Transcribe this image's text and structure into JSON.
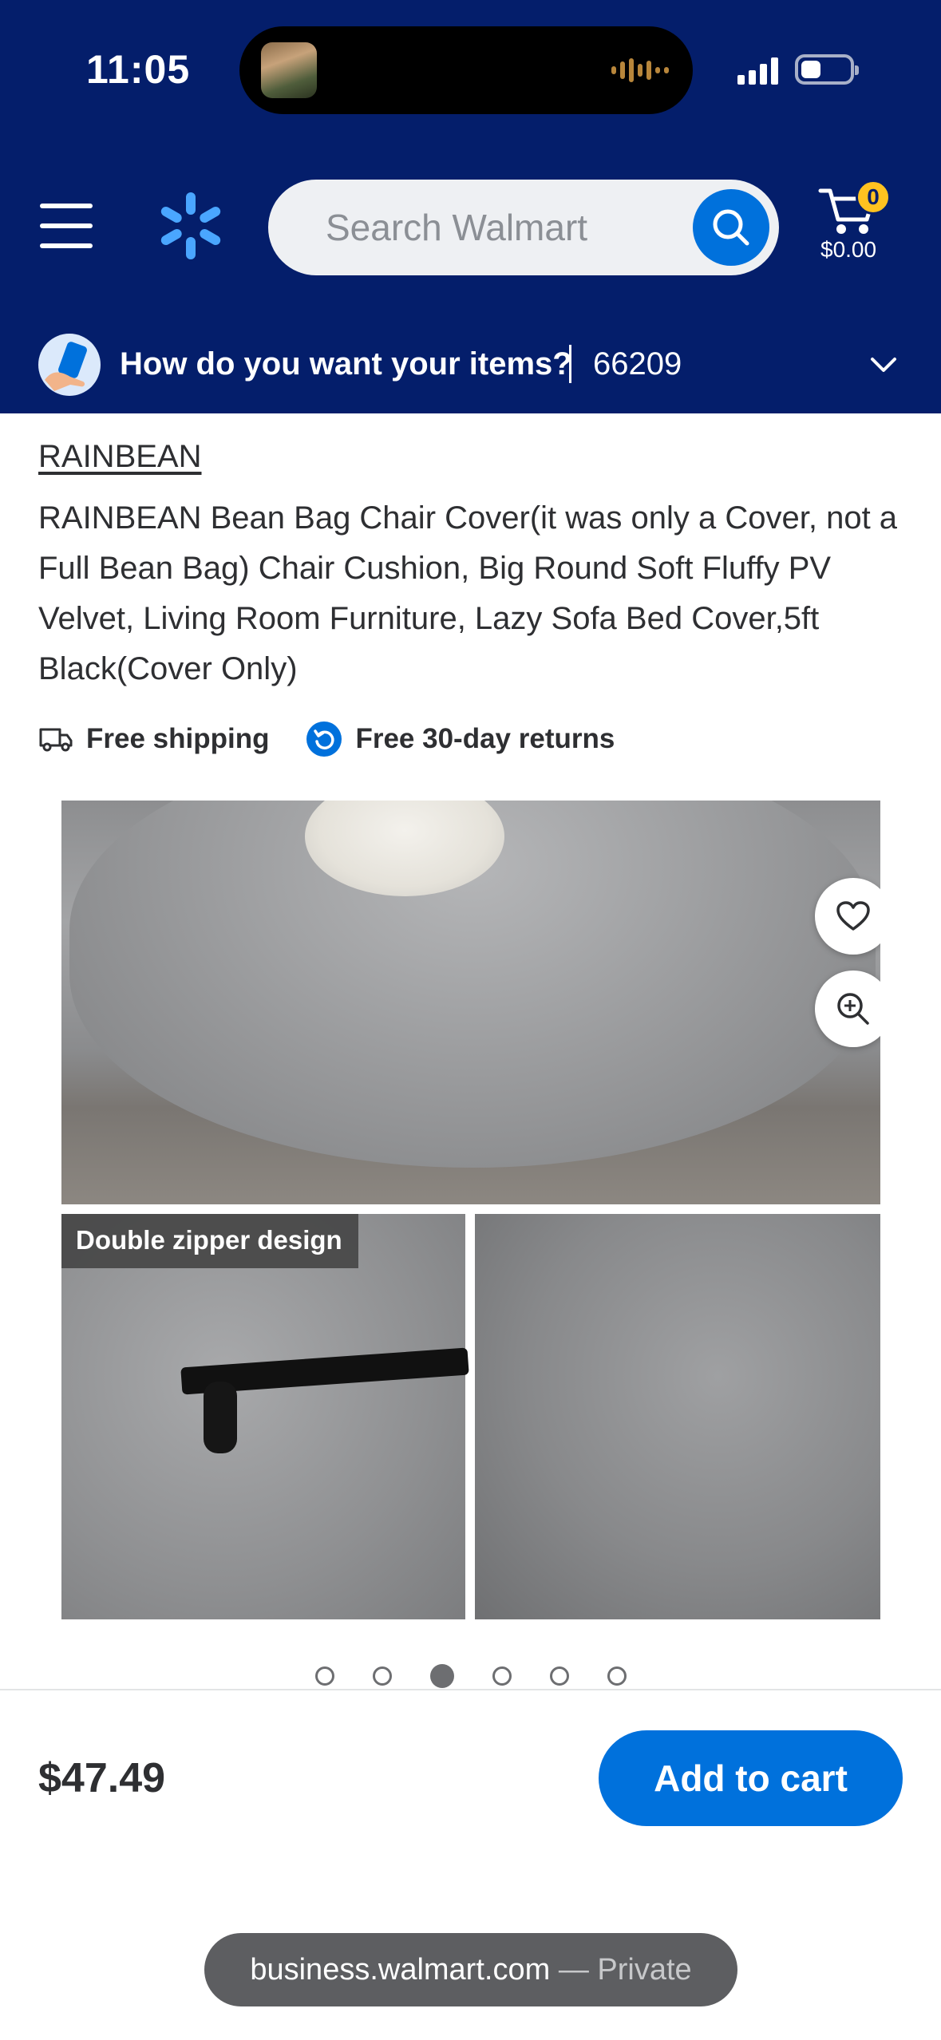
{
  "status_bar": {
    "time": "11:05"
  },
  "header": {
    "search": {
      "placeholder": "Search Walmart"
    },
    "cart": {
      "count": "0",
      "total": "$0.00"
    },
    "delivery": {
      "prompt": "How do you want your items?",
      "zip": "66209"
    }
  },
  "product": {
    "brand": "RAINBEAN",
    "title": "RAINBEAN Bean Bag Chair Cover(it was only a Cover, not a Full Bean Bag) Chair Cushion, Big Round Soft Fluffy PV Velvet, Living Room Furniture, Lazy Sofa Bed Cover,5ft Black(Cover Only)",
    "perks": [
      "Free shipping",
      "Free 30-day returns"
    ],
    "gallery": {
      "caption": "Double zipper design",
      "image_count": 6,
      "active_index": 2
    },
    "price": "$47.49",
    "add_to_cart_label": "Add to cart"
  },
  "browser": {
    "domain": "business.walmart.com",
    "mode": "— Private"
  },
  "colors": {
    "header_bg": "#041e6b",
    "accent_blue": "#0071dc",
    "badge_yellow": "#ffc220"
  }
}
